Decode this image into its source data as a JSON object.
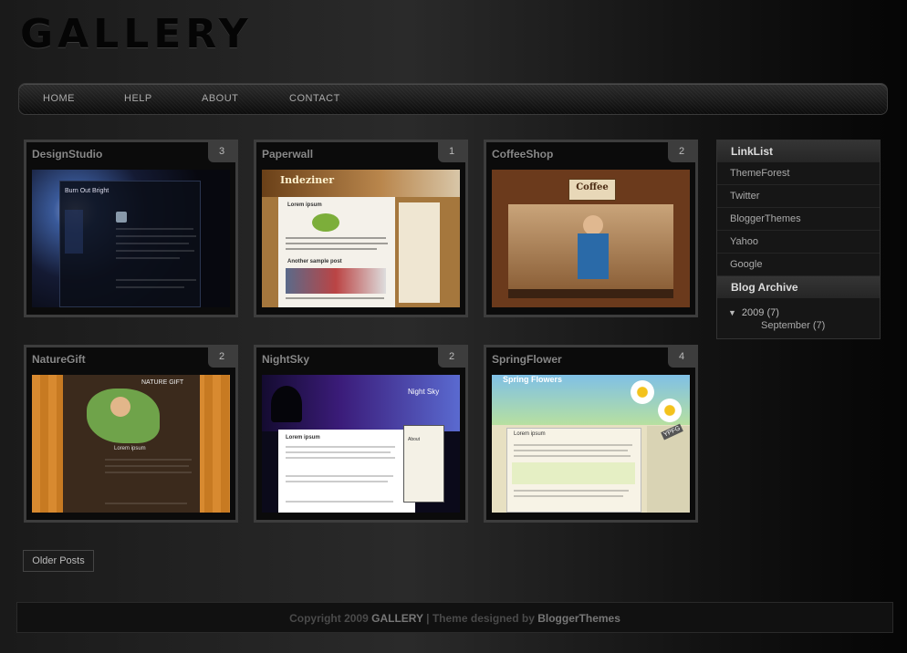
{
  "site": {
    "title": "GALLERY"
  },
  "nav": {
    "items": [
      "HOME",
      "HELP",
      "ABOUT",
      "CONTACT"
    ]
  },
  "posts": [
    {
      "title": "DesignStudio",
      "count": "3"
    },
    {
      "title": "Paperwall",
      "count": "1"
    },
    {
      "title": "CoffeeShop",
      "count": "2"
    },
    {
      "title": "NatureGift",
      "count": "2"
    },
    {
      "title": "NightSky",
      "count": "2"
    },
    {
      "title": "SpringFlower",
      "count": "4"
    }
  ],
  "thumbs": {
    "designstudio": {
      "heading": "Burn Out Bright"
    },
    "paperwall": {
      "logo": "Indeziner",
      "post1": "Lorem ipsum",
      "post2": "Another sample post"
    },
    "coffeeshop": {
      "logo": "Coffee"
    },
    "naturegift": {
      "heading": "NATURE GIFT",
      "post": "Lorem ipsum"
    },
    "nightsky": {
      "heading": "Night Sky",
      "post": "Lorem ipsum",
      "side": "About"
    },
    "springflower": {
      "heading": "Spring Flowers",
      "post": "Lorem ipsum",
      "tag": "YPFG"
    }
  },
  "sidebar": {
    "linklist_title": "LinkList",
    "links": [
      "ThemeForest",
      "Twitter",
      "BloggerThemes",
      "Yahoo",
      "Google"
    ],
    "archive_title": "Blog Archive",
    "archive_year": "2009 (7)",
    "archive_month": "September (7)"
  },
  "pagination": {
    "older_label": "Older Posts"
  },
  "footer": {
    "copyright_prefix": "Copyright 2009",
    "site_name": "GALLERY",
    "designed_by": "| Theme designed by",
    "designer": "BloggerThemes"
  },
  "colors": {
    "background": "#1a1a1a",
    "card_border": "#3d3d3d",
    "accent": "#777777"
  }
}
